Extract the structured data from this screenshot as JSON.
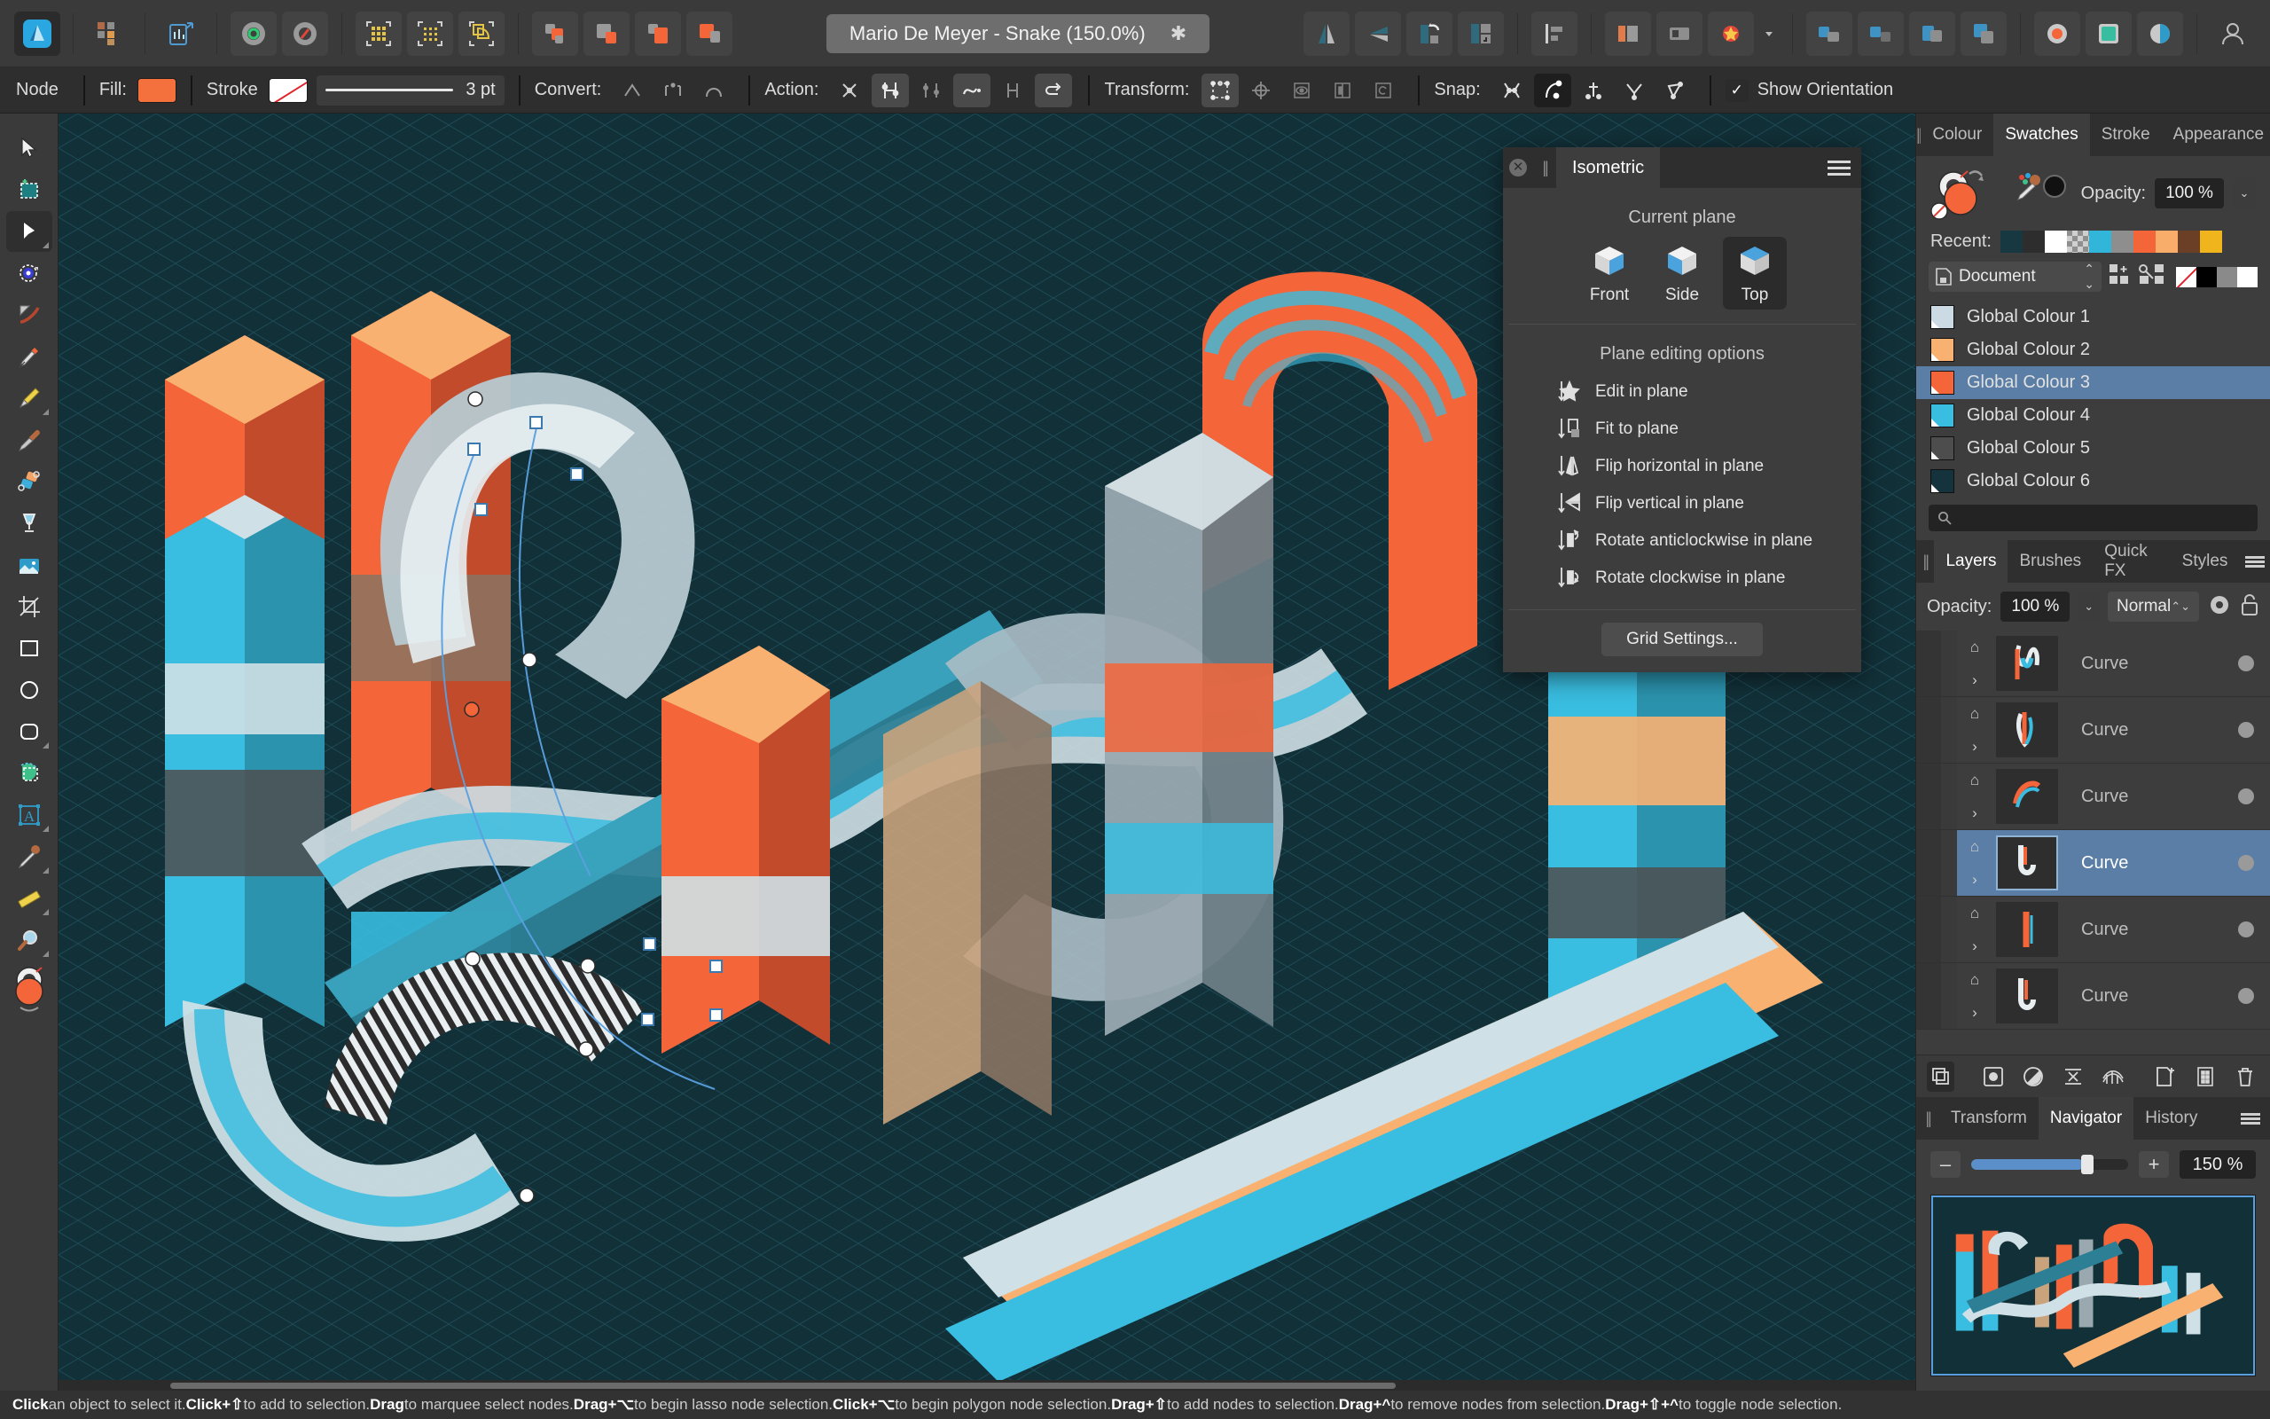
{
  "app": {
    "title": "Affinity Designer",
    "document_tab": {
      "label": "Mario De Meyer - Snake (150.0%)",
      "modified_marker": "✱"
    }
  },
  "context_bar": {
    "mode_label": "Node",
    "fill_label": "Fill:",
    "fill_color": "#f4703c",
    "stroke_label": "Stroke",
    "stroke_color": "none",
    "stroke_width": "3 pt",
    "convert_label": "Convert:",
    "action_label": "Action:",
    "transform_label": "Transform:",
    "snap_label": "Snap:",
    "show_orientation_label": "Show Orientation",
    "show_orientation_checked": true
  },
  "tools": [
    {
      "name": "move-tool",
      "icon": "cursor-arrow"
    },
    {
      "name": "node-selection-tool",
      "icon": "marquee-plus"
    },
    {
      "name": "node-tool",
      "icon": "black-arrow",
      "active": true
    },
    {
      "name": "corner-tool",
      "icon": "corner-node"
    },
    {
      "name": "contour-tool",
      "icon": "contour"
    },
    {
      "name": "pen-tool",
      "icon": "pen-nib"
    },
    {
      "name": "pencil-tool",
      "icon": "pencil"
    },
    {
      "name": "vector-brush-tool",
      "icon": "brush"
    },
    {
      "name": "shape-builder-tool",
      "icon": "shape-builder"
    },
    {
      "name": "fill-tool",
      "icon": "gradient-glass"
    },
    {
      "name": "place-image-tool",
      "icon": "image"
    },
    {
      "name": "crop-tool",
      "icon": "crop"
    },
    {
      "name": "rectangle-tool",
      "icon": "rectangle"
    },
    {
      "name": "ellipse-tool",
      "icon": "ellipse"
    },
    {
      "name": "rounded-rectangle-tool",
      "icon": "rounded-rect"
    },
    {
      "name": "vector-crop-tool",
      "icon": "vector-crop"
    },
    {
      "name": "artistic-text-tool",
      "icon": "text-a"
    },
    {
      "name": "colour-picker-tool",
      "icon": "eyedropper"
    },
    {
      "name": "measure-tool",
      "icon": "ruler"
    },
    {
      "name": "zoom-tool",
      "icon": "magnifier"
    },
    {
      "name": "colour-selector",
      "icon": "colour-wheel"
    }
  ],
  "isometric_panel": {
    "title": "Isometric",
    "current_plane_label": "Current plane",
    "planes": [
      {
        "label": "Front",
        "active": false
      },
      {
        "label": "Side",
        "active": false
      },
      {
        "label": "Top",
        "active": true
      }
    ],
    "editing_label": "Plane editing options",
    "options": [
      {
        "label": "Edit in plane",
        "icon": "edit-in-plane-icon"
      },
      {
        "label": "Fit to plane",
        "icon": "fit-to-plane-icon"
      },
      {
        "label": "Flip horizontal in plane",
        "icon": "flip-horizontal-icon"
      },
      {
        "label": "Flip vertical in plane",
        "icon": "flip-vertical-icon"
      },
      {
        "label": "Rotate anticlockwise in plane",
        "icon": "rotate-anticlockwise-icon"
      },
      {
        "label": "Rotate clockwise in plane",
        "icon": "rotate-clockwise-icon"
      }
    ],
    "grid_settings_label": "Grid Settings..."
  },
  "swatches_panel": {
    "tabs": [
      {
        "label": "Colour",
        "active": false
      },
      {
        "label": "Swatches",
        "active": true
      },
      {
        "label": "Stroke",
        "active": false
      },
      {
        "label": "Appearance",
        "active": false
      }
    ],
    "opacity_label": "Opacity:",
    "opacity_value": "100 %",
    "recent_label": "Recent:",
    "recent_colors": [
      "#173840",
      "#2d2d2d",
      "#ffffff",
      "#b4b4b4",
      "#31b5d8",
      "#8e8e8e",
      "#f4653a",
      "#f8ae6a",
      "#6b3f25",
      "#f0b51c"
    ],
    "palette_source": "Document",
    "palette_chips": [
      "none",
      "#000000",
      "#8a8a8a",
      "#ffffff"
    ],
    "swatches": [
      {
        "label": "Global Colour 1",
        "color": "#ccdbe3",
        "selected": false
      },
      {
        "label": "Global Colour 2",
        "color": "#f9b172",
        "selected": false
      },
      {
        "label": "Global Colour 3",
        "color": "#f4653a",
        "selected": true
      },
      {
        "label": "Global Colour 4",
        "color": "#39bde0",
        "selected": false
      },
      {
        "label": "Global Colour 5",
        "color": "#4d4d4d",
        "selected": false
      },
      {
        "label": "Global Colour 6",
        "color": "#15333d",
        "selected": false
      }
    ],
    "search_placeholder": ""
  },
  "layers_panel": {
    "tabs": [
      {
        "label": "Layers",
        "active": true
      },
      {
        "label": "Brushes",
        "active": false
      },
      {
        "label": "Quick FX",
        "active": false
      },
      {
        "label": "Styles",
        "active": false
      }
    ],
    "opacity_label": "Opacity:",
    "opacity_value": "100 %",
    "blend_mode": "Normal",
    "rows": [
      {
        "name": "Curve",
        "selected": false
      },
      {
        "name": "Curve",
        "selected": false
      },
      {
        "name": "Curve",
        "selected": false
      },
      {
        "name": "Curve",
        "selected": true
      },
      {
        "name": "Curve",
        "selected": false
      },
      {
        "name": "Curve",
        "selected": false
      }
    ]
  },
  "navigator_panel": {
    "tabs": [
      {
        "label": "Transform",
        "active": false
      },
      {
        "label": "Navigator",
        "active": true
      },
      {
        "label": "History",
        "active": false
      }
    ],
    "zoom_out": "–",
    "zoom_in": "+",
    "zoom_value": "150 %"
  },
  "status_bar": {
    "segments": [
      {
        "bold": "Click",
        "text": " an object to select it. "
      },
      {
        "bold": "Click+⇧",
        "text": " to add to selection. "
      },
      {
        "bold": "Drag",
        "text": " to marquee select nodes. "
      },
      {
        "bold": "Drag+⌥",
        "text": " to begin lasso node selection. "
      },
      {
        "bold": "Click+⌥",
        "text": " to begin polygon node selection. "
      },
      {
        "bold": "Drag+⇧",
        "text": " to add nodes to selection. "
      },
      {
        "bold": "Drag+^",
        "text": " to remove nodes from selection. "
      },
      {
        "bold": "Drag+⇧+^",
        "text": " to toggle node selection."
      }
    ]
  },
  "theme": {
    "accent_orange": "#f4653a",
    "accent_blue": "#39bde0",
    "canvas_bg": "#123038",
    "selection_blue": "#5a7ea6",
    "panel_bg": "#3d3d3d"
  }
}
